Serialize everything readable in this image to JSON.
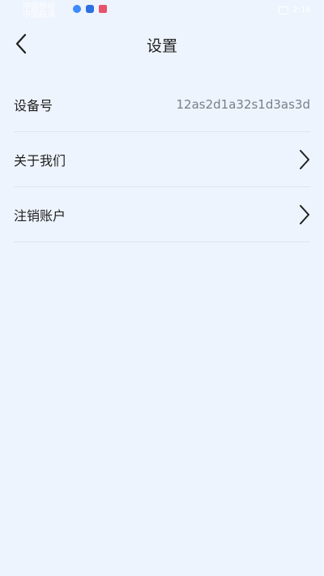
{
  "status_bar": {
    "carrier_top": "中国移动",
    "carrier_bottom": "中国联通",
    "time": "2:16",
    "app_dot_colors": [
      "#3d8bfd",
      "#2b6fe0",
      "#e8536b"
    ]
  },
  "header": {
    "title": "设置",
    "back_icon": "chevron-left-icon"
  },
  "settings": {
    "device": {
      "label": "设备号",
      "value": "12as2d1a32s1d3as3d"
    },
    "about": {
      "label": "关于我们",
      "icon": "chevron-right-icon"
    },
    "logout": {
      "label": "注销账户",
      "icon": "chevron-right-icon"
    }
  }
}
